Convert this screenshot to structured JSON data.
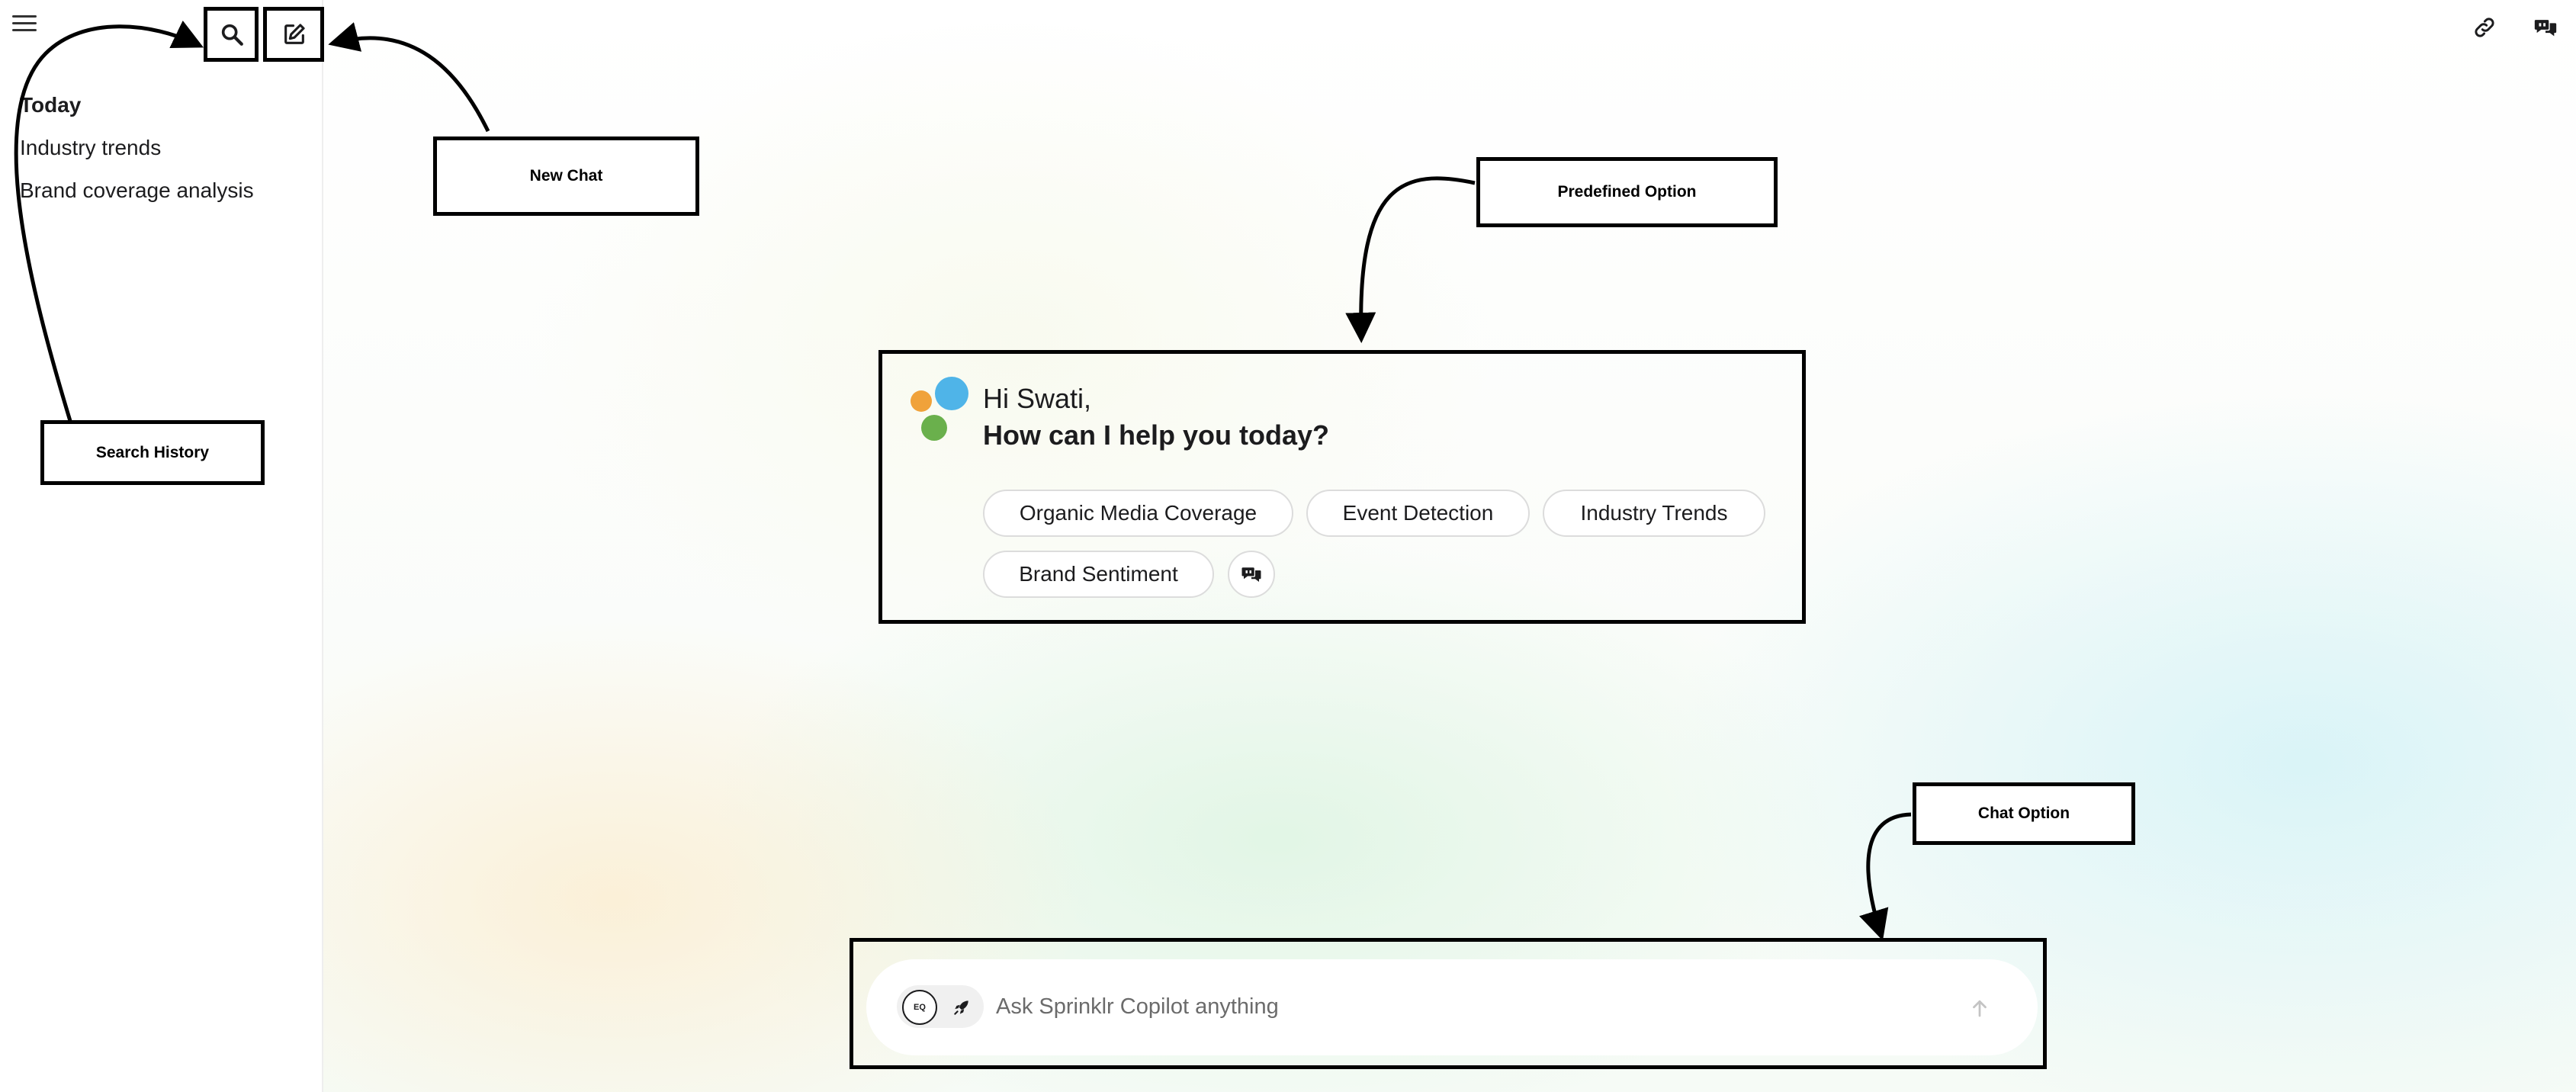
{
  "sidebar": {
    "history_heading": "Today",
    "history_items": [
      "Industry trends",
      "Brand coverage analysis"
    ]
  },
  "greeting": {
    "line1": "Hi Swati,",
    "line2": "How can I help you today?"
  },
  "predefined_options": [
    "Organic Media Coverage",
    "Event Detection",
    "Industry Trends",
    "Brand Sentiment"
  ],
  "chat": {
    "placeholder": "Ask Sprinklr Copilot anything",
    "mode_badge": "EQ"
  },
  "annotations": {
    "search_history": "Search History",
    "new_chat": "New Chat",
    "predefined_option": "Predefined Option",
    "chat_option": "Chat Option"
  },
  "colors": {
    "dot_orange": "#f0a23a",
    "dot_blue": "#4fb4e8",
    "dot_green": "#6ab04c"
  },
  "icons": [
    "menu-icon",
    "search-icon",
    "edit-icon",
    "link-icon",
    "feedback-icon",
    "rocket-icon",
    "arrow-up-icon"
  ]
}
